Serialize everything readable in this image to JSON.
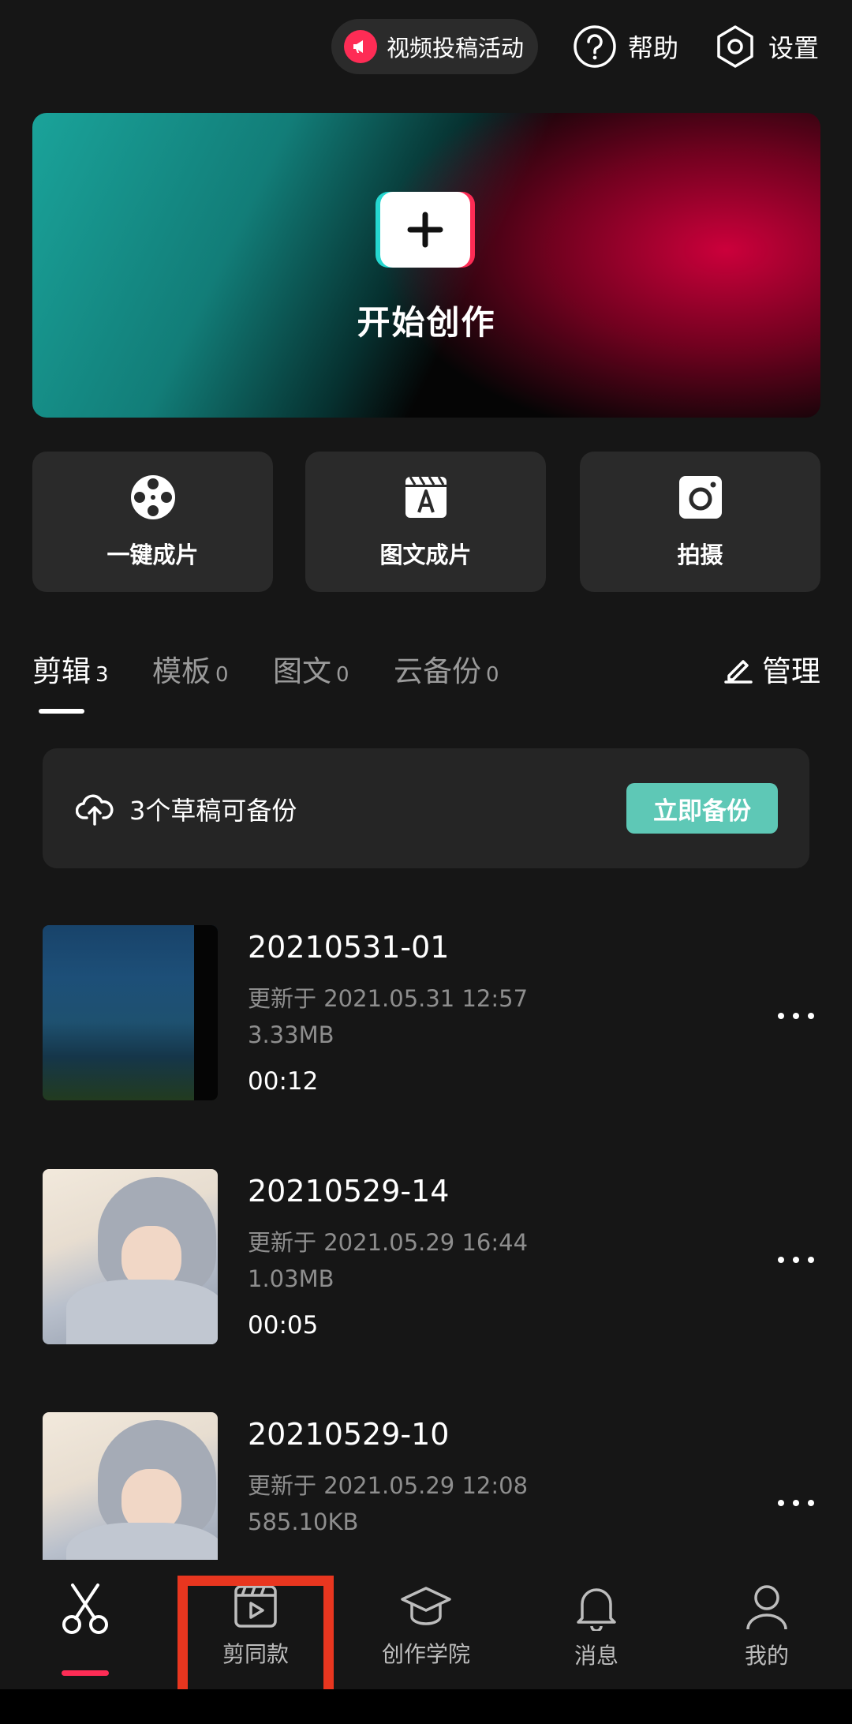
{
  "top_bar": {
    "campaign_label": "视频投稿活动",
    "help_label": "帮助",
    "settings_label": "设置"
  },
  "hero": {
    "title": "开始创作"
  },
  "quick_actions": [
    {
      "label": "一键成片",
      "icon": "film-reel-icon"
    },
    {
      "label": "图文成片",
      "icon": "text-to-video-icon"
    },
    {
      "label": "拍摄",
      "icon": "camera-icon"
    }
  ],
  "tabs": [
    {
      "label": "剪辑",
      "count": "3",
      "active": true
    },
    {
      "label": "模板",
      "count": "0",
      "active": false
    },
    {
      "label": "图文",
      "count": "0",
      "active": false
    },
    {
      "label": "云备份",
      "count": "0",
      "active": false
    }
  ],
  "manage_label": "管理",
  "backup_banner": {
    "text": "3个草稿可备份",
    "button_label": "立即备份"
  },
  "drafts": [
    {
      "title": "20210531-01",
      "updated": "更新于 2021.05.31 12:57",
      "size": "3.33MB",
      "duration": "00:12"
    },
    {
      "title": "20210529-14",
      "updated": "更新于 2021.05.29 16:44",
      "size": "1.03MB",
      "duration": "00:05"
    },
    {
      "title": "20210529-10",
      "updated": "更新于 2021.05.29 12:08",
      "size": "585.10KB",
      "duration": ""
    }
  ],
  "bottom_nav": [
    {
      "label": "",
      "icon": "scissors-icon",
      "active": true
    },
    {
      "label": "剪同款",
      "icon": "clapper-play-icon",
      "active": false
    },
    {
      "label": "创作学院",
      "icon": "graduation-cap-icon",
      "active": false
    },
    {
      "label": "消息",
      "icon": "bell-icon",
      "active": false
    },
    {
      "label": "我的",
      "icon": "person-icon",
      "active": false
    }
  ],
  "colors": {
    "background": "#161616",
    "accent_pink": "#fe2c55",
    "accent_teal": "#5ec8b6",
    "highlight_red": "#e8361f"
  }
}
